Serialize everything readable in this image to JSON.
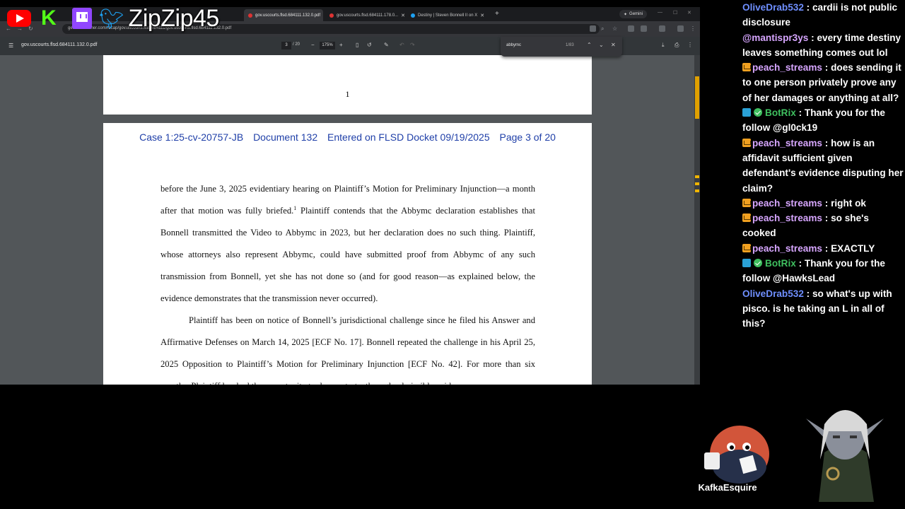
{
  "overlay": {
    "handle": "ZipZip45",
    "logos": [
      "youtube-logo",
      "kick-logo",
      "twitch-logo",
      "twitter-bird-logo"
    ]
  },
  "browser": {
    "tabs": [
      {
        "label": "gov.uscourts.flsd.684111.132.0.pdf",
        "active": true
      },
      {
        "label": "gov.uscourts.flsd.684111.178.0...",
        "active": false
      },
      {
        "label": "Destiny | Steven Bonnell II on X",
        "active": false
      }
    ],
    "gemini_label": "Gemini",
    "url": "ge.courtlistener.com/recap/gov.uscourts.flsd.684111/gov.uscourts.flsd.684111.132.0.pdf"
  },
  "pdf": {
    "title": "gov.uscourts.flsd.684111.132.0.pdf",
    "current_page": "3",
    "total_pages": "/ 20",
    "zoom": "175%"
  },
  "find": {
    "query": "abbymc",
    "count": "1/83"
  },
  "document": {
    "prev_page_number": "1",
    "docket": {
      "case": "Case 1:25-cv-20757-JB",
      "doc": "Document 132",
      "entered": "Entered on FLSD Docket 09/19/2025",
      "page": "Page 3 of 20"
    },
    "para1_a": "before the June 3, 2025 evidentiary hearing on Plaintiff’s Motion for Preliminary Injunction—a month after that motion was fully briefed.",
    "para1_fn": "1",
    "para1_b": " Plaintiff contends that the Abbymc declaration establishes that Bonnell transmitted the Video to Abbymc in 2023, but her declaration does no such thing. Plaintiff, whose attorneys also represent Abbymc, could have submitted proof from Abbymc of any such transmission from Bonnell, yet she has not done so (and for good reason—as explained below, the evidence demonstrates that the transmission never occurred).",
    "para2": "Plaintiff has been on notice of Bonnell’s jurisdictional challenge since he filed his Answer and Affirmative Defenses on March 14, 2025 [ECF No. 17]. Bonnell repeated the challenge in his April 25, 2025 Opposition to Plaintiff’s Motion for Preliminary Injunction [ECF No. 42]. For more than six months, Plaintiff has had the opportunity to demonstrate, through admissible evidence,"
  },
  "chat": [
    {
      "user": "OliveDrab532",
      "color": "#6f8fff",
      "badges": [],
      "text": "cardii is not public disclosure"
    },
    {
      "user": "@mantispr3ys",
      "color": "#d7a6ff",
      "badges": [],
      "text": "every time destiny leaves something comes out lol"
    },
    {
      "user": "peach_streams",
      "color": "#d7a6ff",
      "badges": [
        "crown"
      ],
      "text": "does sending it to one person privately prove any of her damages or anything at all?"
    },
    {
      "user": "BotRix",
      "color": "#3fbf5f",
      "badges": [
        "bot",
        "check"
      ],
      "text": "Thank you for the follow @gl0ck19"
    },
    {
      "user": "peach_streams",
      "color": "#d7a6ff",
      "badges": [
        "crown"
      ],
      "text": "how is an affidavit sufficient given defendant's evidence disputing her claim?"
    },
    {
      "user": "peach_streams",
      "color": "#d7a6ff",
      "badges": [
        "crown"
      ],
      "text": "right ok"
    },
    {
      "user": "peach_streams",
      "color": "#d7a6ff",
      "badges": [
        "crown"
      ],
      "text": "so she's cooked"
    },
    {
      "user": "peach_streams",
      "color": "#d7a6ff",
      "badges": [
        "crown"
      ],
      "text": "EXACTLY"
    },
    {
      "user": "BotRix",
      "color": "#3fbf5f",
      "badges": [
        "bot",
        "check"
      ],
      "text": "Thank you for the follow @HawksLead"
    },
    {
      "user": "OliveDrab532",
      "color": "#6f8fff",
      "badges": [],
      "text": "so what's up with pisco. is he taking an L in all of this?"
    }
  ],
  "avatars": {
    "kafka_label": "KafkaEsquire"
  }
}
